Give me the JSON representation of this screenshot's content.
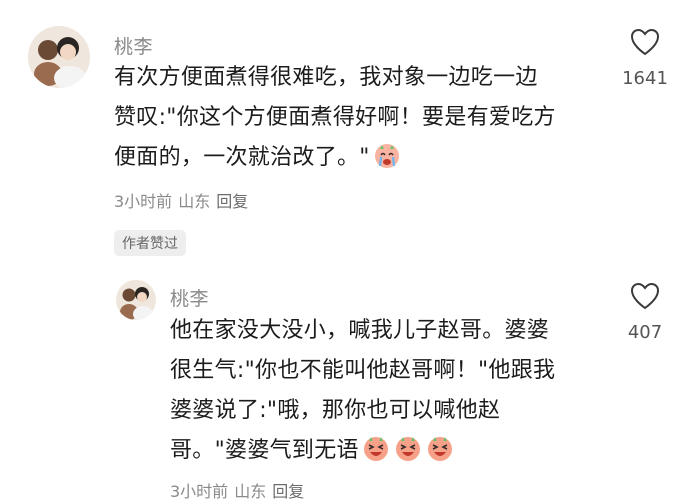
{
  "comments": [
    {
      "username": "桃李",
      "lines": [
        "有次方便面煮得很难吃，我对象一边吃一边",
        "赞叹:\"你这个方便面煮得好啊！要是有爱吃方",
        "便面的，一次就治改了。\""
      ],
      "emojis": [
        "crying-face-emoji"
      ],
      "time": "3小时前",
      "location": "山东",
      "reply_label": "回复",
      "likes": "1641",
      "author_badge": "作者赞过"
    },
    {
      "username": "桃李",
      "lines": [
        "他在家没大没小，喊我儿子赵哥。婆婆",
        "很生气:\"你也不能叫他赵哥啊！\"他跟我",
        "婆婆说了:\"哦，那你也可以喊他赵",
        "哥。\"婆婆气到无语"
      ],
      "emojis": [
        "laughing-face-emoji",
        "laughing-face-emoji",
        "laughing-face-emoji"
      ],
      "time": "3小时前",
      "location": "山东",
      "reply_label": "回复",
      "likes": "407"
    }
  ],
  "colors": {
    "text": "#1c1c1c",
    "muted": "#8a8a8a",
    "emoji": "#f7a08a"
  }
}
